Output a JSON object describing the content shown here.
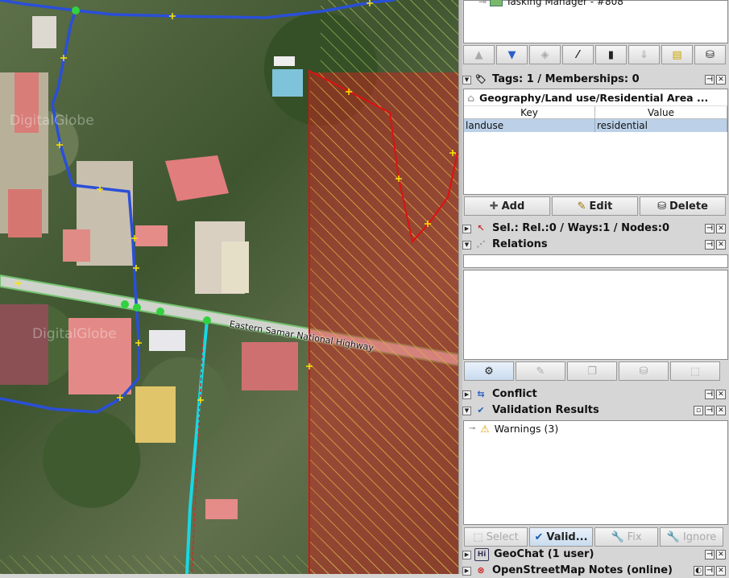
{
  "map": {
    "road_label": "Eastern Samar National Highway",
    "watermarks": [
      "DigitalGlobe",
      "DigitalGlobe"
    ]
  },
  "layers": {
    "item_label": "Tasking Manager - #808"
  },
  "tags_panel": {
    "title": "Tags: 1 / Memberships: 0",
    "preset": "Geography/Land use/Residential Area ...",
    "columns": [
      "Key",
      "Value"
    ],
    "rows": [
      {
        "key": "landuse",
        "value": "residential"
      }
    ],
    "buttons": {
      "add": "Add",
      "edit": "Edit",
      "delete": "Delete"
    }
  },
  "selection_panel": {
    "title": "Sel.: Rel.:0 / Ways:1 / Nodes:0"
  },
  "relations_panel": {
    "title": "Relations"
  },
  "conflict_panel": {
    "title": "Conflict"
  },
  "validation_panel": {
    "title": "Validation Results",
    "items": [
      "Warnings (3)"
    ],
    "buttons": {
      "select": "Select",
      "validate": "Valid...",
      "fix": "Fix",
      "ignore": "Ignore"
    }
  },
  "geochat_panel": {
    "title": "GeoChat (1 user)"
  },
  "notes_panel": {
    "title": "OpenStreetMap Notes (online)"
  },
  "colors": {
    "accent_blue": "#2a4fd8",
    "area_red": "#e01010",
    "road_green": "#73c26e",
    "selection_blue": "#bcd1e8"
  }
}
